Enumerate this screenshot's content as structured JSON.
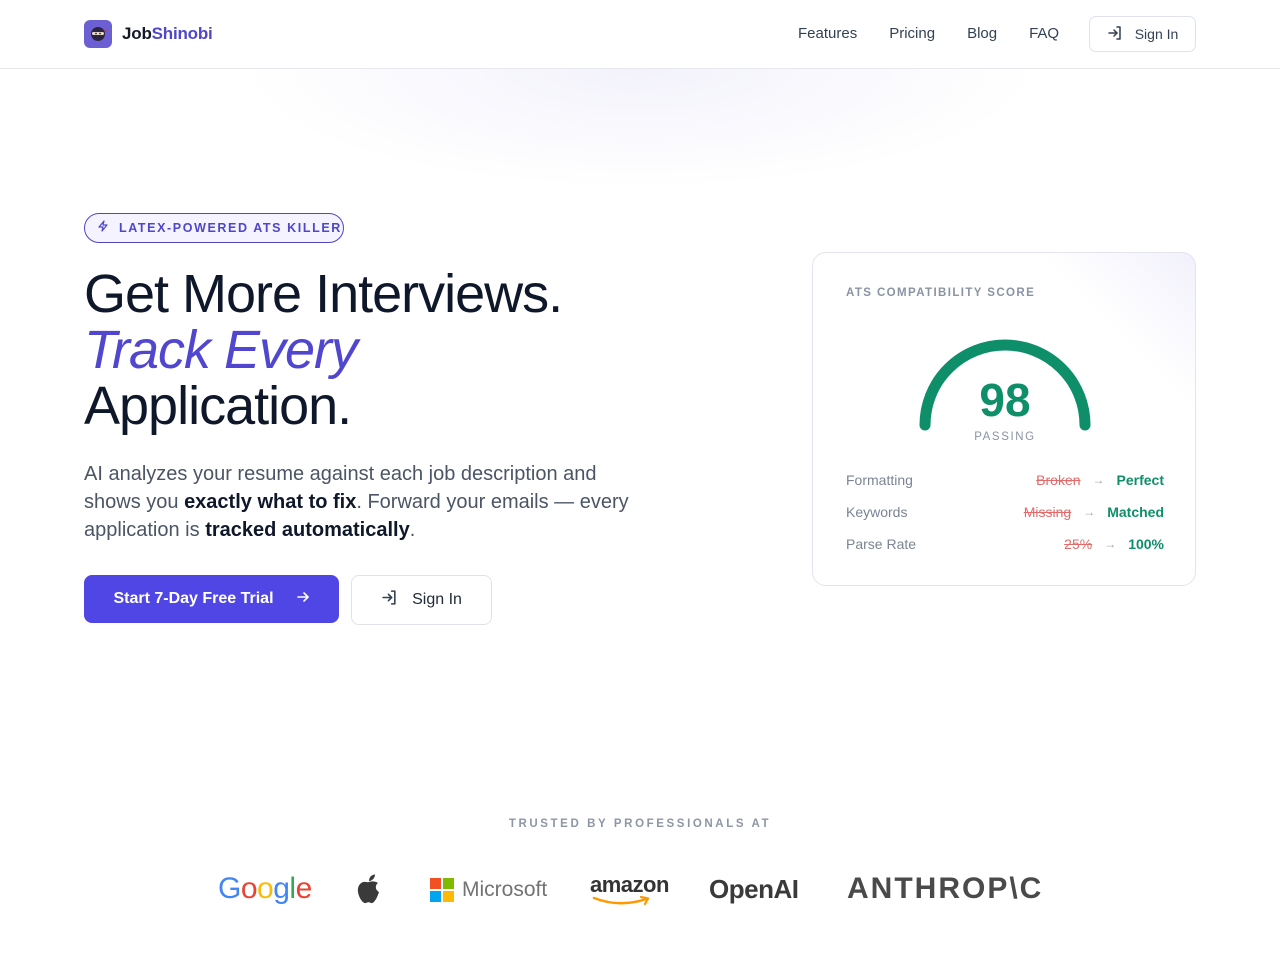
{
  "brand": {
    "name_part1": "Job",
    "name_part2": "Shinobi",
    "logo_icon": "ninja-icon"
  },
  "nav": {
    "links": [
      "Features",
      "Pricing",
      "Blog",
      "FAQ"
    ],
    "signin_label": "Sign In",
    "signin_icon": "sign-in-icon"
  },
  "hero": {
    "badge": "LATEX-POWERED ATS KILLER",
    "badge_icon": "lightning-icon",
    "headline_line1": "Get More Interviews.",
    "headline_line2": "Track Every",
    "headline_line3": "Application.",
    "lede_part1": "AI analyzes your resume against each job description and shows you ",
    "lede_bold1": "exactly what to fix",
    "lede_part2": ". Forward your emails — every application is ",
    "lede_bold2": "tracked automatically",
    "lede_part3": ".",
    "cta_primary": "Start 7-Day Free Trial",
    "cta_secondary": "Sign In"
  },
  "score_card": {
    "title": "ATS COMPATIBILITY SCORE",
    "score": "98",
    "score_value": 98,
    "status": "PASSING",
    "rows": [
      {
        "label": "Formatting",
        "before": "Broken",
        "after": "Perfect"
      },
      {
        "label": "Keywords",
        "before": "Missing",
        "after": "Matched"
      },
      {
        "label": "Parse Rate",
        "before": "25%",
        "after": "100%"
      }
    ],
    "colors": {
      "good": "#0e8f6a",
      "bad": "#e06c6c"
    }
  },
  "trusted": {
    "heading": "TRUSTED BY PROFESSIONALS AT",
    "logos": [
      "Google",
      "Apple",
      "Microsoft",
      "amazon",
      "OpenAI",
      "ANTHROP\\C"
    ]
  },
  "colors": {
    "accent": "#4f46e5",
    "brand_purple": "#4f46c8"
  }
}
